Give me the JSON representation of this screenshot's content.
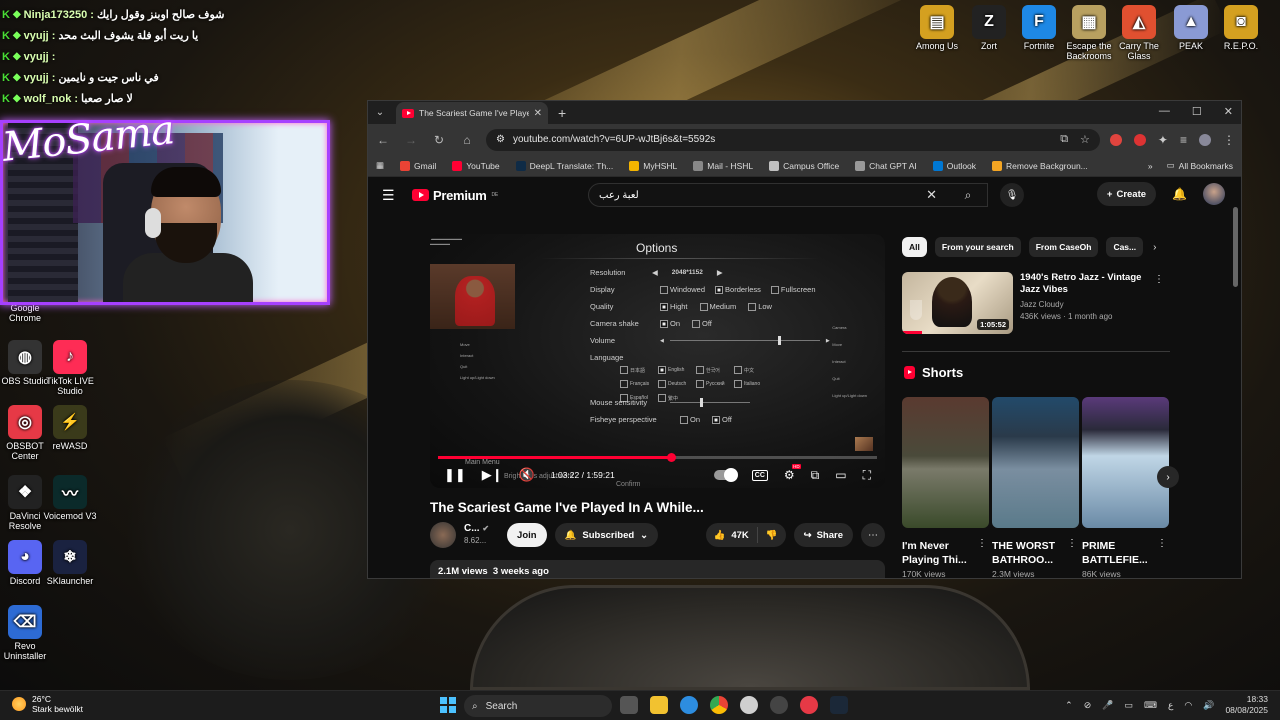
{
  "chat": [
    {
      "user": "Ninja173250",
      "msg": "شوف صالح اوبنز وقول رايك"
    },
    {
      "user": "vyujj",
      "msg": "يا ريت أبو فلة يشوف البث محد"
    },
    {
      "user": "vyujj",
      "msg": ""
    },
    {
      "user": "vyujj",
      "msg": "في ناس جيت و نايمين"
    },
    {
      "user": "wolf_nok",
      "msg": "لا صار صعبا"
    }
  ],
  "streamer_name": "MoSama",
  "desktop_left": [
    {
      "label": "Google Chrome",
      "color": "#2a7ae4",
      "glyph": "◉"
    },
    {
      "label": "OBS Studio",
      "color": "#333",
      "glyph": "◍"
    },
    {
      "label": "TikTok LIVE Studio",
      "color": "#fe2c55",
      "glyph": "♪"
    },
    {
      "label": "OBSBOT Center",
      "color": "#e63946",
      "glyph": "◎"
    },
    {
      "label": "reWASD",
      "color": "#3a3a1a",
      "glyph": "⚡"
    },
    {
      "label": "DaVinci Resolve",
      "color": "#222",
      "glyph": "❖"
    },
    {
      "label": "Voicemod V3",
      "color": "#0b2a2a",
      "glyph": "〰"
    },
    {
      "label": "Discord",
      "color": "#5865f2",
      "glyph": "◕"
    },
    {
      "label": "SKlauncher",
      "color": "#1a2240",
      "glyph": "❄"
    },
    {
      "label": "Revo Uninstaller",
      "color": "#2d6bd4",
      "glyph": "⌫"
    }
  ],
  "desktop_top": [
    {
      "label": "Among Us",
      "color": "#d4a020",
      "glyph": "▤"
    },
    {
      "label": "Zort",
      "color": "#222",
      "glyph": "Z"
    },
    {
      "label": "Fortnite",
      "color": "#1e88e5",
      "glyph": "F"
    },
    {
      "label": "Escape the Backrooms",
      "color": "#b8a060",
      "glyph": "▦"
    },
    {
      "label": "Carry The Glass",
      "color": "#e05030",
      "glyph": "◭"
    },
    {
      "label": "PEAK",
      "color": "#8a9ad4",
      "glyph": "▲"
    },
    {
      "label": "R.E.P.O.",
      "color": "#d4a020",
      "glyph": "◙"
    }
  ],
  "browser": {
    "tab_title": "The Scariest Game I've Played In A While...",
    "url": "youtube.com/watch?v=6UP-wJtBj6s&t=5592s",
    "bookmarks": [
      {
        "label": "Gmail",
        "color": "#ea4335"
      },
      {
        "label": "YouTube",
        "color": "#ff0033"
      },
      {
        "label": "DeepL Translate: Th...",
        "color": "#0f2b46"
      },
      {
        "label": "MyHSHL",
        "color": "#f4b400"
      },
      {
        "label": "Mail - HSHL",
        "color": "#888"
      },
      {
        "label": "Campus Office",
        "color": "#c0c0c0"
      },
      {
        "label": "Chat GPT AI",
        "color": "#999"
      },
      {
        "label": "Outlook",
        "color": "#0078d4"
      },
      {
        "label": "Remove Backgroun...",
        "color": "#f5a623"
      }
    ],
    "all_bookmarks": "All Bookmarks"
  },
  "youtube": {
    "logo": "Premium",
    "region": "DE",
    "search_query": "لعبة رعب",
    "create": "Create",
    "player": {
      "options_title": "Options",
      "resolution_label": "Resolution",
      "resolution_value": "2048*1152",
      "display_label": "Display",
      "display_opts": [
        "Windowed",
        "Borderless",
        "Fullscreen"
      ],
      "display_selected": 1,
      "quality_label": "Quality",
      "quality_opts": [
        "Hight",
        "Medium",
        "Low"
      ],
      "quality_selected": 0,
      "shake_label": "Camera shake",
      "shake_opts": [
        "On",
        "Off"
      ],
      "shake_selected": 0,
      "volume_label": "Volume",
      "volume_level": 0.72,
      "language_label": "Language",
      "mouse_label": "Mouse sensitivity",
      "mouse_level": 0.38,
      "fisheye_label": "Fisheye perspective",
      "fisheye_opts": [
        "On",
        "Off"
      ],
      "fisheye_selected": 1,
      "bottom_menu": "Main Menu",
      "bottom_brightness": "Brightness adjustment",
      "bottom_confirm": "Confirm",
      "current_time": "1:03:22",
      "duration": "1:59:21",
      "progress": 0.531
    },
    "video_title": "The Scariest Game I've Played In A While...",
    "channel_name": "C...",
    "subscribers": "8.62...",
    "join": "Join",
    "subscribed": "Subscribed",
    "likes": "47K",
    "share": "Share",
    "views": "2.1M views",
    "age": "3 weeks ago",
    "chips": [
      "All",
      "From your search",
      "From CaseOh",
      "Cas..."
    ],
    "rec": {
      "title": "1940's Retro Jazz - Vintage Jazz Vibes",
      "channel": "Jazz Cloudy",
      "meta": "436K views · 1 month ago",
      "duration": "1:05:52"
    },
    "shorts_label": "Shorts",
    "shorts": [
      {
        "title": "I'm Never Playing Thi...",
        "views": "170K views"
      },
      {
        "title": "THE WORST BATHROO...",
        "views": "2.3M views"
      },
      {
        "title": "PRIME BATTLEFIE...",
        "views": "86K views"
      }
    ]
  },
  "taskbar": {
    "temp": "26°C",
    "weather": "Stark bewölkt",
    "search": "Search",
    "time": "18:33",
    "date": "08/08/2025",
    "lang": "ع"
  }
}
